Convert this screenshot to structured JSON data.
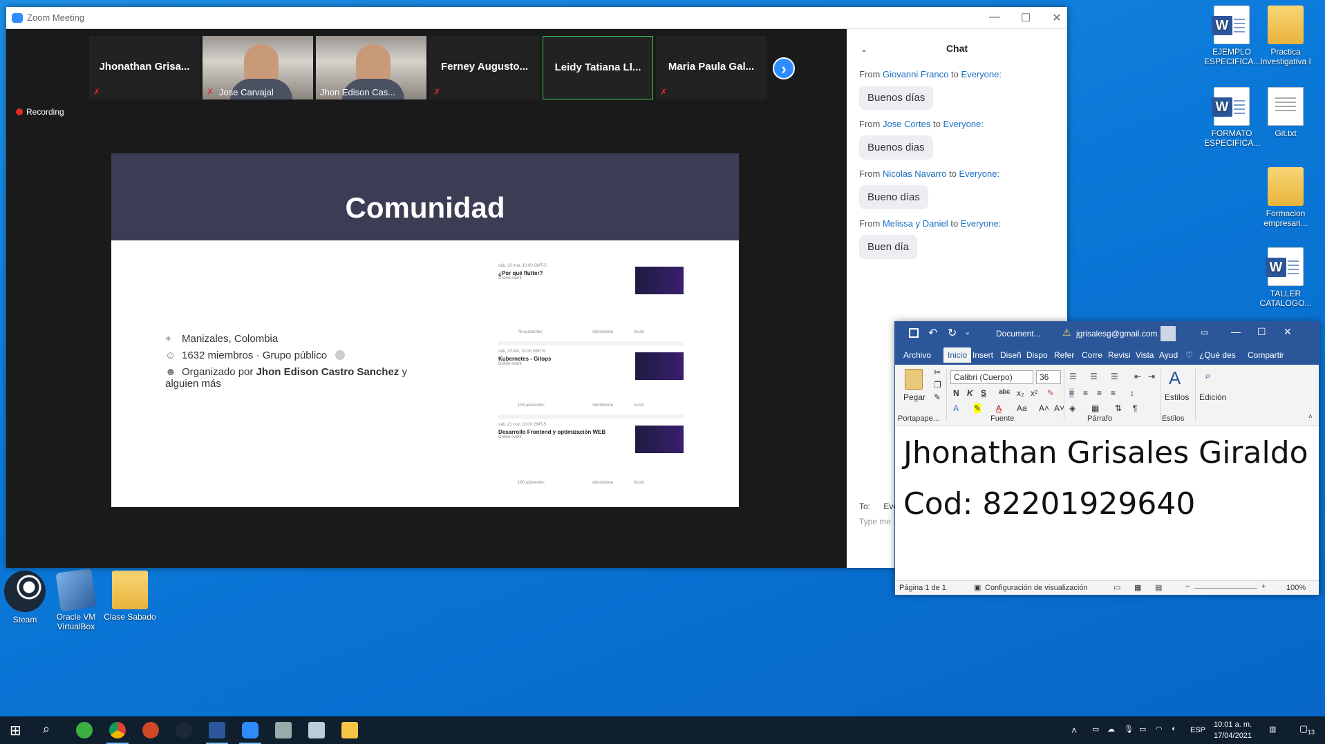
{
  "desktop": {
    "icons_right": [
      {
        "label": "EJEMPLO ESPECIFICA...",
        "icon": "word-doc-icon"
      },
      {
        "label": "Practica Investigativa I",
        "icon": "folder-icon"
      },
      {
        "label": "FORMATO ESPECIFICA...",
        "icon": "word-doc-icon"
      },
      {
        "label": "Git.txt",
        "icon": "text-file-icon"
      },
      {
        "label": "Formacion empresari...",
        "icon": "folder-icon"
      },
      {
        "label": "TALLER CATALOGO...",
        "icon": "word-doc-icon"
      }
    ],
    "icons_bottom": [
      {
        "label": "Steam",
        "icon": "steam-icon"
      },
      {
        "label": "Oracle VM VirtualBox",
        "icon": "virtualbox-icon"
      },
      {
        "label": "Clase Sabado",
        "icon": "folder-icon"
      }
    ]
  },
  "zoom": {
    "title": "Zoom Meeting",
    "recording": "Recording",
    "participants": [
      {
        "name": "Jhonathan Grisa...",
        "video": false,
        "muted": true
      },
      {
        "name": "Jose Carvajal",
        "video": true,
        "muted": true
      },
      {
        "name": "Jhon Edison Cas...",
        "video": true,
        "muted": false
      },
      {
        "name": "Ferney Augusto...",
        "video": false,
        "muted": true
      },
      {
        "name": "Leidy Tatiana Ll...",
        "video": false,
        "muted": false
      },
      {
        "name": "Maria Paula Gal...",
        "video": false,
        "muted": true
      }
    ],
    "slide": {
      "title": "Comunidad",
      "location": "Manizales, Colombia",
      "members": "1632 miembros · Grupo público",
      "organized_prefix": "Organizado por",
      "organizer": "Jhon Edison Castro Sanchez",
      "organized_suffix": "y alguien más",
      "events": [
        {
          "date": "sáb, 20 mar, 10:00 GMT-5",
          "title": "¿Por qué flutter?",
          "type": "Online event",
          "attendees": "78 asistentes"
        },
        {
          "date": "sáb, 20 feb, 10:00 GMT-5",
          "title": "Kubernetes - Gitops",
          "type": "Online event",
          "attendees": "103 asistentes"
        },
        {
          "date": "sáb, 21 nov, 10:00 GMT-5",
          "title": "Desarrollo Frontend y optimización WEB",
          "type": "Online event",
          "attendees": "160 asistentes"
        }
      ],
      "manage_label": "Administrar",
      "attend_label": "Asistí"
    },
    "chat": {
      "title": "Chat",
      "messages": [
        {
          "from": "Giovanni Franco",
          "to": "Everyone:",
          "text": "Buenos días"
        },
        {
          "from": "Jose Cortes",
          "to": "Everyone:",
          "text": "Buenos dias"
        },
        {
          "from": "Nicolas Navarro",
          "to": "Everyone:",
          "text": "Bueno días"
        },
        {
          "from": "Melissa y Daniel",
          "to": "Everyone:",
          "text": "Buen día"
        }
      ],
      "from_word": "From",
      "to_word": "to",
      "to_label": "To:",
      "to_value": "Ever",
      "input_placeholder": "Type me"
    }
  },
  "word": {
    "doc_title": "Document...",
    "user": "jgrisalesg@gmail.com",
    "tabs": [
      "Archivo",
      "Inicio",
      "Insert",
      "Diseñ",
      "Dispo",
      "Refer",
      "Corre",
      "Revisi",
      "Vista",
      "Ayud"
    ],
    "tell_me": "¿Qué des",
    "share": "Compartir",
    "font_name": "Calibri (Cuerpo)",
    "font_size": "36",
    "paste_label": "Pegar",
    "styles_label": "Estilos",
    "editing_label": "Edición",
    "groups": [
      "Portapape...",
      "Fuente",
      "Párrafo",
      "Estilos"
    ],
    "doc_lines": [
      "Jhonathan Grisales Giraldo",
      "Cod: 82201929640"
    ],
    "status_page": "Página 1 de 1",
    "status_view": "Configuración de visualización",
    "zoom_level": "100%"
  },
  "taskbar": {
    "lang": "ESP",
    "time": "10:01 a. m.",
    "date": "17/04/2021",
    "notifications": "13"
  },
  "colors": {
    "zoom_blue": "#2d8cff",
    "word_blue": "#2b579a",
    "slide_header": "#3c3d55",
    "chat_name": "#1b6fc2"
  }
}
